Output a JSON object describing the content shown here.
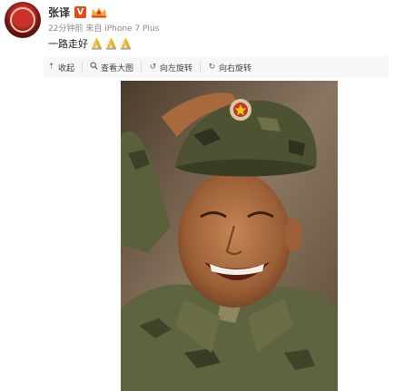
{
  "post": {
    "username": "张译",
    "vip_badge": "V",
    "meta_time": "22分钟前",
    "meta_from_prefix": "来自",
    "meta_source": "iPhone 7 Plus",
    "text": "一路走好",
    "emoji_icons": [
      "folded-hands-icon",
      "folded-hands-icon",
      "folded-hands-icon"
    ]
  },
  "toolbar": {
    "collapse_label": "收起",
    "view_large_label": "查看大图",
    "rotate_left_label": "向左旋转",
    "rotate_right_label": "向右旋转"
  },
  "colors": {
    "username": "#333333",
    "meta": "#8a8a8a",
    "vip_badge": "#e64a19",
    "toolbar_bg": "#f7f7f7"
  }
}
